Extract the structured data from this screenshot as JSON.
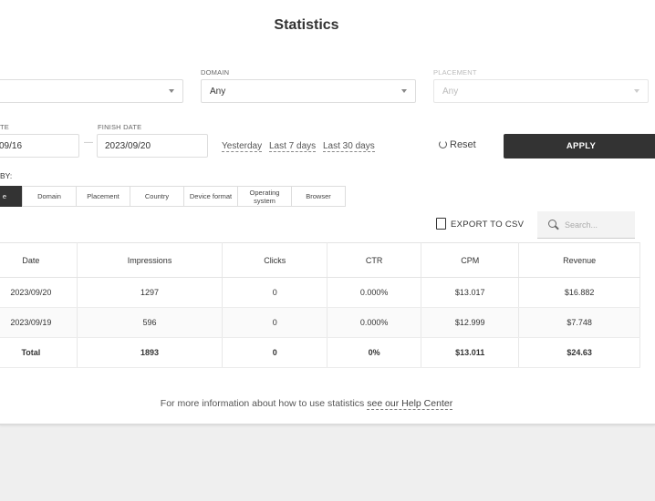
{
  "page": {
    "title": "Statistics"
  },
  "filters": {
    "domain": {
      "label": "DOMAIN",
      "value": "Any"
    },
    "placement": {
      "label": "PLACEMENT",
      "value": "Any"
    },
    "start_date": {
      "label": "TE",
      "value": "09/16"
    },
    "finish_date": {
      "label": "FINISH DATE",
      "value": "2023/09/20"
    },
    "range_separator": "—",
    "quick_ranges": [
      "Yesterday",
      "Last 7 days",
      "Last 30 days"
    ],
    "reset_label": "Reset",
    "apply_label": "APPLY"
  },
  "group_by": {
    "label": "BY:",
    "tabs": [
      {
        "label": "e",
        "active": true
      },
      {
        "label": "Domain"
      },
      {
        "label": "Placement"
      },
      {
        "label": "Country"
      },
      {
        "label": "Device format"
      },
      {
        "label": "Operating system"
      },
      {
        "label": "Browser"
      }
    ]
  },
  "toolbar": {
    "export_label": "EXPORT TO CSV",
    "search_placeholder": "Search..."
  },
  "table": {
    "columns": [
      "Date",
      "Impressions",
      "Clicks",
      "CTR",
      "CPM",
      "Revenue"
    ],
    "rows": [
      [
        "2023/09/20",
        "1297",
        "0",
        "0.000%",
        "$13.017",
        "$16.882"
      ],
      [
        "2023/09/19",
        "596",
        "0",
        "0.000%",
        "$12.999",
        "$7.748"
      ]
    ],
    "total": [
      "Total",
      "1893",
      "0",
      "0%",
      "$13.011",
      "$24.63"
    ]
  },
  "footer": {
    "text": "For more information about how to use statistics ",
    "link": "see our Help Center"
  },
  "colors": {
    "accent": "#333333",
    "background": "#efefef"
  }
}
